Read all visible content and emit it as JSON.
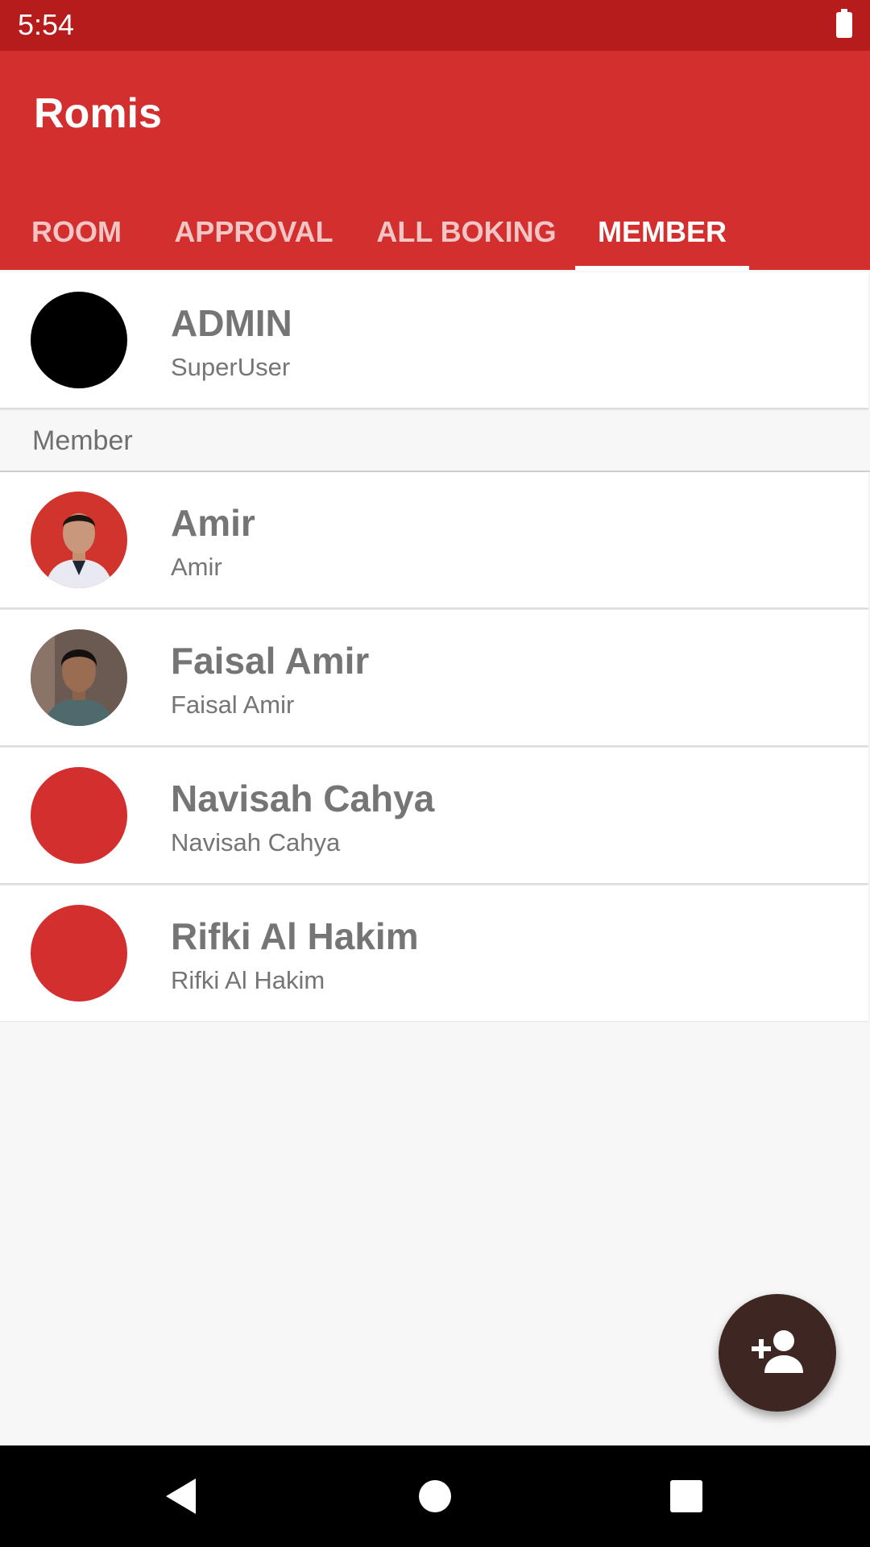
{
  "status_bar": {
    "time": "5:54",
    "battery_icon": "battery-full-icon"
  },
  "app_bar": {
    "title": "Romis",
    "tabs": [
      {
        "label": "ROOM",
        "active": false
      },
      {
        "label": "APPROVAL",
        "active": false
      },
      {
        "label": "ALL BOKING",
        "active": false
      },
      {
        "label": "MEMBER",
        "active": true
      }
    ]
  },
  "admin": {
    "name": "ADMIN",
    "role": "SuperUser",
    "avatar_color": "#000000"
  },
  "section": {
    "label": "Member"
  },
  "members": [
    {
      "name": "Amir",
      "subtitle": "Amir",
      "avatar": "photo"
    },
    {
      "name": "Faisal Amir",
      "subtitle": "Faisal Amir",
      "avatar": "photo"
    },
    {
      "name": "Navisah Cahya",
      "subtitle": "Navisah Cahya",
      "avatar_color": "#d32f2f"
    },
    {
      "name": "Rifki Al Hakim",
      "subtitle": "Rifki Al Hakim",
      "avatar_color": "#d32f2f"
    }
  ],
  "fab": {
    "icon": "add-person-icon"
  },
  "nav_bar": {
    "icons": [
      "back-icon",
      "home-icon",
      "recents-icon"
    ]
  },
  "colors": {
    "primary": "#d32f2f",
    "primary_dark": "#b71c1c",
    "fab": "#3e2723"
  }
}
